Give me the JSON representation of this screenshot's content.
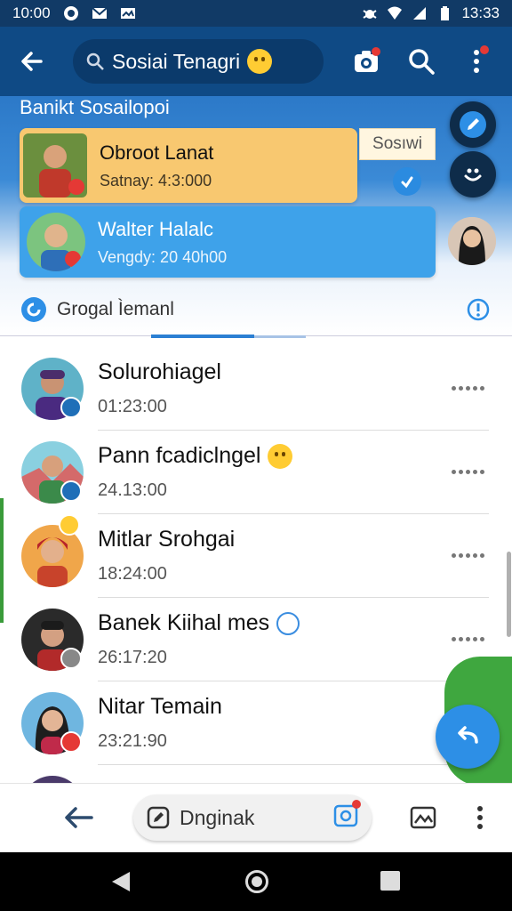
{
  "status_bar": {
    "time_left": "10:00",
    "time_right": "13:33"
  },
  "app_bar": {
    "search_text": "Sosiai Tenagri"
  },
  "banner": {
    "title": "Banikt Sosailopoi",
    "card_orange": {
      "title": "Obroot Lanat",
      "subtitle": "Satnay: 4:3:000"
    },
    "card_blue": {
      "title": "Walter Halalc",
      "subtitle": "Vengdy: 20 40h00"
    },
    "tag": "Sosıwi",
    "group_label": "Grogal Ìemanl"
  },
  "chats": [
    {
      "name": "Solurohiagel",
      "time": "01:23:00"
    },
    {
      "name": "Pann fcadiclngel",
      "time": "24.13:00"
    },
    {
      "name": "Mitlar Srohgai",
      "time": "18:24:00"
    },
    {
      "name": "Banek Kiihal mes",
      "time": "26:17:20"
    },
    {
      "name": "Nitar Temain",
      "time": "23:21:90"
    }
  ],
  "bottom_bar": {
    "pill_text": "Dnginak"
  },
  "colors": {
    "app_bar": "#0f4a85",
    "accent_blue": "#2d8fe6",
    "card_orange": "#f8c870",
    "card_blue": "#3ea2ea"
  }
}
